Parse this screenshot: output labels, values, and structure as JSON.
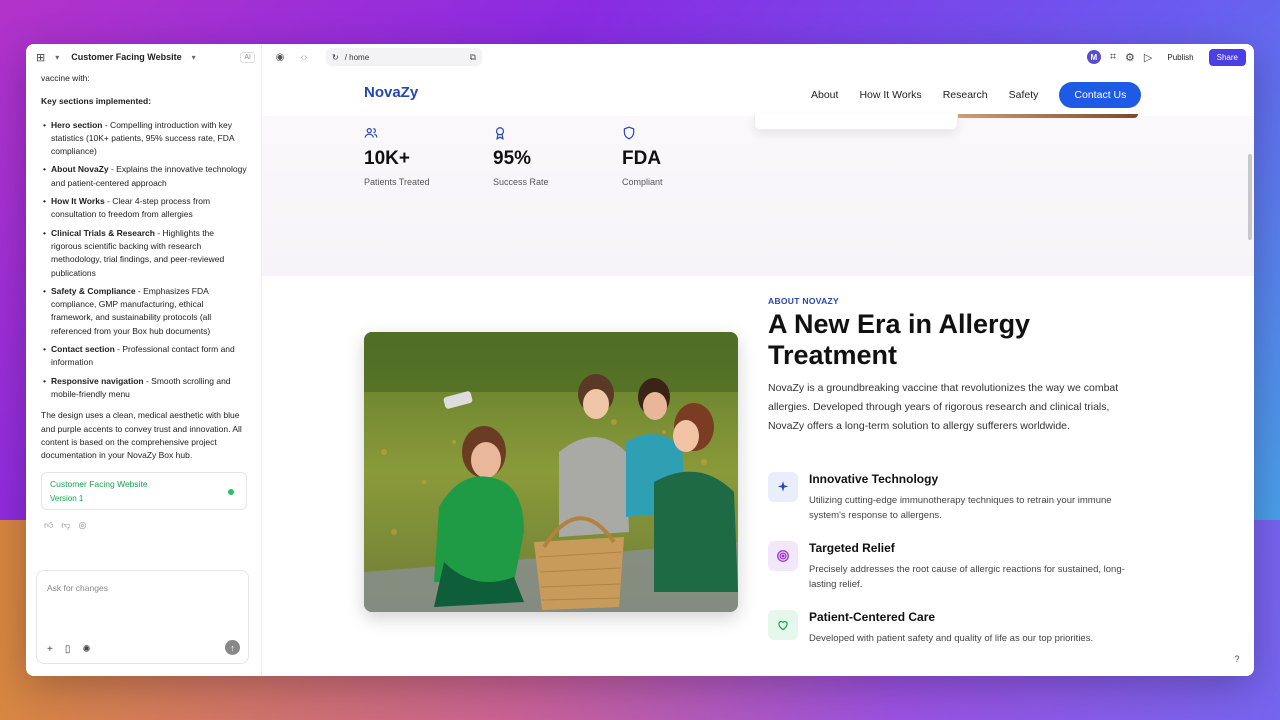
{
  "topbar": {
    "project_name": "Customer Facing Website",
    "ai_badge": "AI",
    "url_path": "/ home",
    "avatar_initial": "M",
    "publish_label": "Publish",
    "share_label": "Share"
  },
  "chat": {
    "intro": "vaccine with:",
    "key_heading": "Key sections implemented:",
    "items": [
      {
        "title": "Hero section",
        "text": " - Compelling introduction with key statistics (10K+ patients, 95% success rate, FDA compliance)"
      },
      {
        "title": "About NovaZy",
        "text": " - Explains the innovative technology and patient-centered approach"
      },
      {
        "title": "How It Works",
        "text": " - Clear 4-step process from consultation to freedom from allergies"
      },
      {
        "title": "Clinical Trials & Research",
        "text": " - Highlights the rigorous scientific backing with research methodology, trial findings, and peer-reviewed publications"
      },
      {
        "title": "Safety & Compliance",
        "text": " - Emphasizes FDA compliance, GMP manufacturing, ethical framework, and sustainability protocols (all referenced from your Box hub documents)"
      },
      {
        "title": "Contact section",
        "text": " - Professional contact form and information"
      },
      {
        "title": "Responsive navigation",
        "text": " - Smooth scrolling and mobile-friendly menu"
      }
    ],
    "closing": "The design uses a clean, medical aesthetic with blue and purple accents to convey trust and innovation. All content is based on the comprehensive project documentation in your NovaZy Box hub.",
    "version_title": "Customer Facing Website",
    "version_sub": "Version 1",
    "input_placeholder": "Ask for changes"
  },
  "site": {
    "brand": "NovaZy",
    "nav": [
      "About",
      "How It Works",
      "Research",
      "Safety"
    ],
    "contact_label": "Contact Us",
    "stats": [
      {
        "icon": "users-icon",
        "value": "10K+",
        "label": "Patients Treated"
      },
      {
        "icon": "award-icon",
        "value": "95%",
        "label": "Success Rate"
      },
      {
        "icon": "shield-icon",
        "value": "FDA",
        "label": "Compliant"
      }
    ],
    "about_kicker": "ABOUT NOVAZY",
    "about_title": "A New Era in Allergy Treatment",
    "about_desc": "NovaZy is a groundbreaking vaccine that revolutionizes the way we combat allergies. Developed through years of rigorous research and clinical trials, NovaZy offers a long-term solution to allergy sufferers worldwide.",
    "features": [
      {
        "icon": "sparkle-icon",
        "title": "Innovative Technology",
        "desc": "Utilizing cutting-edge immunotherapy techniques to retrain your immune system's response to allergens."
      },
      {
        "icon": "target-icon",
        "title": "Targeted Relief",
        "desc": "Precisely addresses the root cause of allergic reactions for sustained, long-lasting relief."
      },
      {
        "icon": "heart-icon",
        "title": "Patient-Centered Care",
        "desc": "Developed with patient safety and quality of life as our top priorities."
      }
    ],
    "help_label": "?"
  },
  "colors": {
    "brand_blue": "#2447b3",
    "button_blue": "#1d5be6",
    "share_purple": "#4b3ee6",
    "version_green": "#16a34a"
  }
}
